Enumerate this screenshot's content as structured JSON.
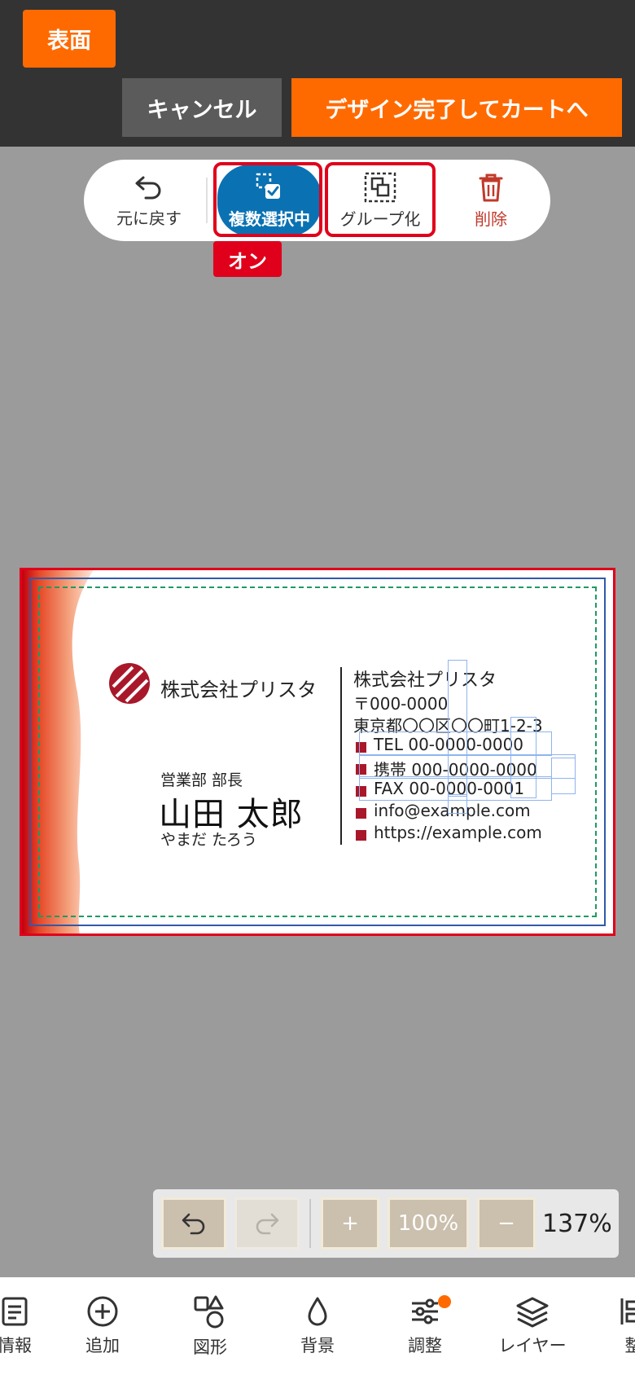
{
  "header": {
    "face_label": "表面",
    "cancel_label": "キャンセル",
    "done_label": "デザイン完了してカートへ"
  },
  "toolbar": {
    "undo_label": "元に戻す",
    "multi_select_label": "複数選択中",
    "group_label": "グループ化",
    "delete_label": "削除",
    "on_badge": "オン"
  },
  "card": {
    "logo_company": "株式会社プリスタ",
    "title": "営業部 部長",
    "name": "山田 太郎",
    "kana": "やまだ たろう",
    "company": "株式会社プリスタ",
    "postal": "〒000-0000",
    "address": "東京都〇〇区〇〇町1-2-3",
    "tel": "TEL 00-0000-0000",
    "mobile": "携帯 000-0000-0000",
    "fax": "FAX 00-0000-0001",
    "email": "info@example.com",
    "url": "https://example.com"
  },
  "zoom": {
    "preset": "100%",
    "plus": "+",
    "minus": "−",
    "level": "137%"
  },
  "nav": {
    "info": "情報",
    "add": "追加",
    "shape": "図形",
    "background": "背景",
    "adjust": "調整",
    "layer": "レイヤー",
    "align": "整"
  },
  "colors": {
    "accent": "#ff6a00",
    "active": "#0a72b3",
    "highlight": "#e0001b",
    "brand": "#a8182a"
  }
}
